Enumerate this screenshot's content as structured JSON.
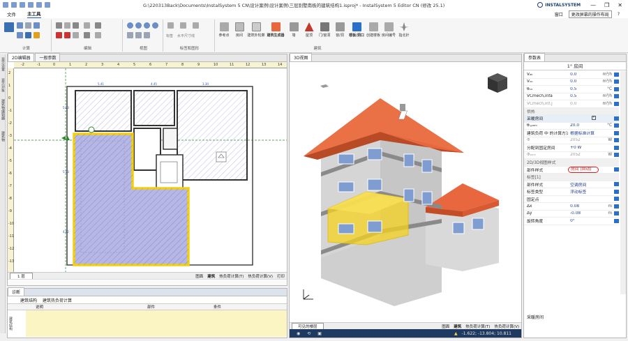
{
  "window": {
    "title": "G:\\220313Back\\Documents\\InstalSystem 5 CN\\设计案例\\设计案例\\三层别墅南极的建筑结构1.isproj* - InstalSystem 5 Editor CN (修改 25.1)",
    "brand": "INSTALSYSTEM"
  },
  "menu": {
    "file": "文件",
    "main": "主工具",
    "view_btn": "窗口",
    "layout_select": "更改屏幕的操作布局"
  },
  "ribbon": {
    "groups": [
      "计算",
      "编辑",
      "视图",
      "标签和图形",
      "建筑"
    ],
    "buttons": [
      "参考点",
      "房间",
      "建筑外轮廓",
      "建筑生成器",
      "墙",
      "屋顶",
      "门/窗洞",
      "窗/洞",
      "楼板/洞口",
      "创建楼板",
      "房间编号",
      "指北针"
    ],
    "label_cmds": [
      "标签",
      "水平尺寸线"
    ]
  },
  "panels": {
    "left_tabs": [
      "2D编辑器",
      "一般参数"
    ],
    "view3d_tab": "3D视图",
    "props_title": "参数表",
    "diag_title": "诊断",
    "left_strip": [
      "显示设置",
      "显示对象",
      "建筑物编辑器",
      "建筑物"
    ],
    "diag_strip": "建筑结构"
  },
  "ruler": {
    "h": [
      "-2",
      "-1",
      "0",
      "1",
      "2",
      "3",
      "4",
      "5",
      "6",
      "7",
      "8",
      "9",
      "10",
      "11",
      "12",
      "13",
      "14"
    ],
    "v": [
      "2",
      "1",
      "0",
      "-1",
      "-2",
      "-3",
      "-4",
      "-5",
      "-6",
      "-7",
      "-8",
      "-9",
      "-10",
      "-11",
      "-12",
      "-13"
    ]
  },
  "plan": {
    "labels": [
      "5.23",
      "5.23",
      "4.62",
      "5.41",
      "4.45",
      "3.30"
    ]
  },
  "status2d": {
    "level": "1 层",
    "items": [
      "图面",
      "建筑",
      "热负荷计算(T)",
      "热负荷计算(V)",
      "打印"
    ]
  },
  "status3d": {
    "level": "可见的楼层",
    "items": [
      "图面",
      "建筑",
      "热负荷计算(T)",
      "热负荷计算(V)",
      "打印"
    ],
    "coords": "-1.622; -13.804; 10.811"
  },
  "diag": {
    "tabs": [
      "建筑结构",
      "建筑热负荷计算"
    ],
    "cols": [
      "说明",
      "部件",
      "条件"
    ]
  },
  "props": {
    "header": "1° 房间",
    "footer": "采暖房间",
    "rows": [
      {
        "name": "Vₐᵢᵣ",
        "value": "0.0",
        "unit": "m³/h",
        "kind": "val"
      },
      {
        "name": "Vₛᵤ",
        "value": "0.0",
        "unit": "m³/h",
        "kind": "val"
      },
      {
        "name": "θₛᵤ",
        "value": "0.5",
        "unit": "°C",
        "kind": "val"
      },
      {
        "name": "VCmech,infa",
        "value": "0.5",
        "unit": "m³/h",
        "kind": "val"
      },
      {
        "name": "VCmech,inf,j",
        "value": "0.0",
        "unit": "m³/h",
        "kind": "grey"
      },
      {
        "name": "供热",
        "value": "",
        "unit": "",
        "kind": "sec"
      },
      {
        "name": "采暖房间",
        "value": "",
        "unit": "",
        "kind": "check"
      },
      {
        "name": "θᵢ,ₚₒₘ",
        "value": "20.0",
        "unit": "°C",
        "kind": "val"
      },
      {
        "name": "建筑负荷 中 的计算方法ₚₒₘ",
        "value": "根据标准计算",
        "unit": "",
        "kind": "val"
      },
      {
        "name": "Φ",
        "value": "2052",
        "unit": "W",
        "kind": "grey"
      },
      {
        "name": "分配到固定房间",
        "value": "+0 W",
        "unit": "",
        "kind": "val"
      },
      {
        "name": "Φₚₒₘ",
        "value": "2052",
        "unit": "W",
        "kind": "grey"
      },
      {
        "name": "2D/3D视图样式",
        "value": "",
        "unit": "",
        "kind": "sec"
      },
      {
        "name": "部件样式",
        "value": "房间 (自动)",
        "unit": "",
        "kind": "circle"
      },
      {
        "name": "标签[1]",
        "value": "",
        "unit": "",
        "kind": "sec"
      },
      {
        "name": "部件样式",
        "value": "空调房间",
        "unit": "",
        "kind": "val"
      },
      {
        "name": "标签类型",
        "value": "浮动标签",
        "unit": "",
        "kind": "val"
      },
      {
        "name": "固定点",
        "value": "",
        "unit": "",
        "kind": "val"
      },
      {
        "name": "Δx",
        "value": "0.08",
        "unit": "m",
        "kind": "val"
      },
      {
        "name": "Δy",
        "value": "-0.08",
        "unit": "m",
        "kind": "val"
      },
      {
        "name": "旋转角度",
        "value": "0°",
        "unit": "",
        "kind": "val"
      }
    ]
  },
  "colors": {
    "accent": "#1e5bb8",
    "roof": "#e8673e",
    "highlight": "#f5d21e",
    "wall": "#d9d9d9",
    "hatch": "#8b8fc8"
  }
}
